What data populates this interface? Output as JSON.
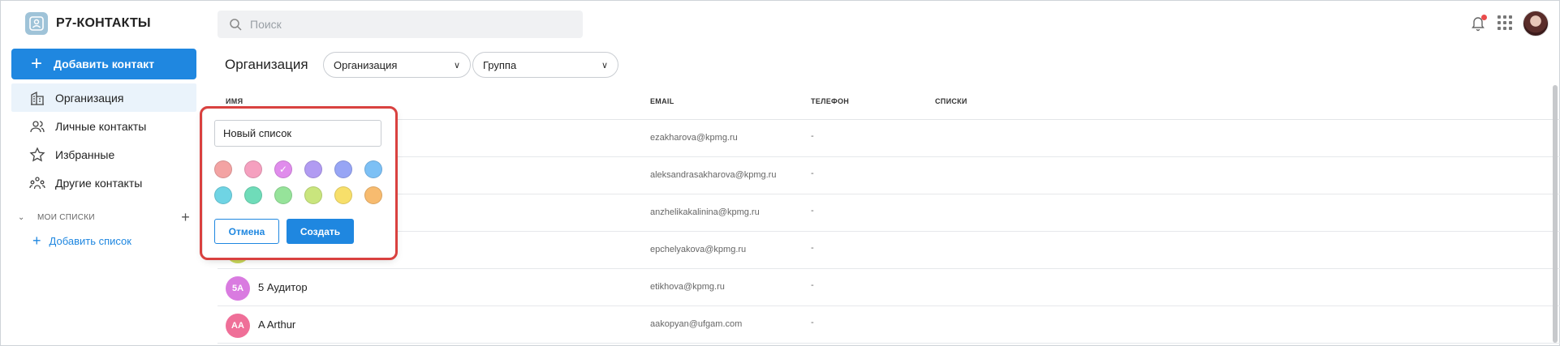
{
  "app": {
    "title": "Р7-КОНТАКТЫ",
    "logo_icon": "contacts-logo-icon"
  },
  "sidebar": {
    "add_contact_label": "Добавить контакт",
    "items": [
      {
        "label": "Организация",
        "icon": "building-icon",
        "active": true
      },
      {
        "label": "Личные контакты",
        "icon": "people-icon",
        "active": false
      },
      {
        "label": "Избранные",
        "icon": "star-icon",
        "active": false
      },
      {
        "label": "Другие контакты",
        "icon": "group-icon",
        "active": false
      }
    ],
    "my_lists_label": "МОИ СПИСКИ",
    "add_list_label": "Добавить список"
  },
  "header": {
    "search_placeholder": "Поиск"
  },
  "toolbar": {
    "title": "Организация",
    "org_select": "Организация",
    "group_select": "Группа"
  },
  "table": {
    "columns": [
      "ИМЯ",
      "EMAIL",
      "ТЕЛЕФОН",
      "СПИСКИ"
    ],
    "rows": [
      {
        "initials": "",
        "name": "",
        "email": "ezakharova@kpmg.ru",
        "phone": "-",
        "color": "#f3a7a7"
      },
      {
        "initials": "",
        "name": "",
        "email": "aleksandrasakharova@kpmg.ru",
        "phone": "-",
        "color": "#f39bbd"
      },
      {
        "initials": "",
        "name": "",
        "email": "anzhelikakalinina@kpmg.ru",
        "phone": "-",
        "color": "#a7a3f0"
      },
      {
        "initials": "",
        "name": "",
        "email": "epchelyakova@kpmg.ru",
        "phone": "-",
        "color": "#c9d85a"
      },
      {
        "initials": "5А",
        "name": "5 Аудитор",
        "email": "etikhova@kpmg.ru",
        "phone": "-",
        "color": "#d97be0"
      },
      {
        "initials": "AA",
        "name": "A Arthur",
        "email": "aakopyan@ufgam.com",
        "phone": "-",
        "color": "#ef6f98"
      }
    ]
  },
  "popup": {
    "input_value": "Новый список",
    "cancel_label": "Отмена",
    "create_label": "Создать",
    "selected_color_index": 2,
    "colors": [
      "#f3a3a3",
      "#f5a0bf",
      "#e08cec",
      "#b19bf2",
      "#97a5f5",
      "#7cc0f5",
      "#6fd4e4",
      "#6fdcb9",
      "#96e39a",
      "#c9e57d",
      "#f7df6a",
      "#f7bb6f"
    ]
  }
}
